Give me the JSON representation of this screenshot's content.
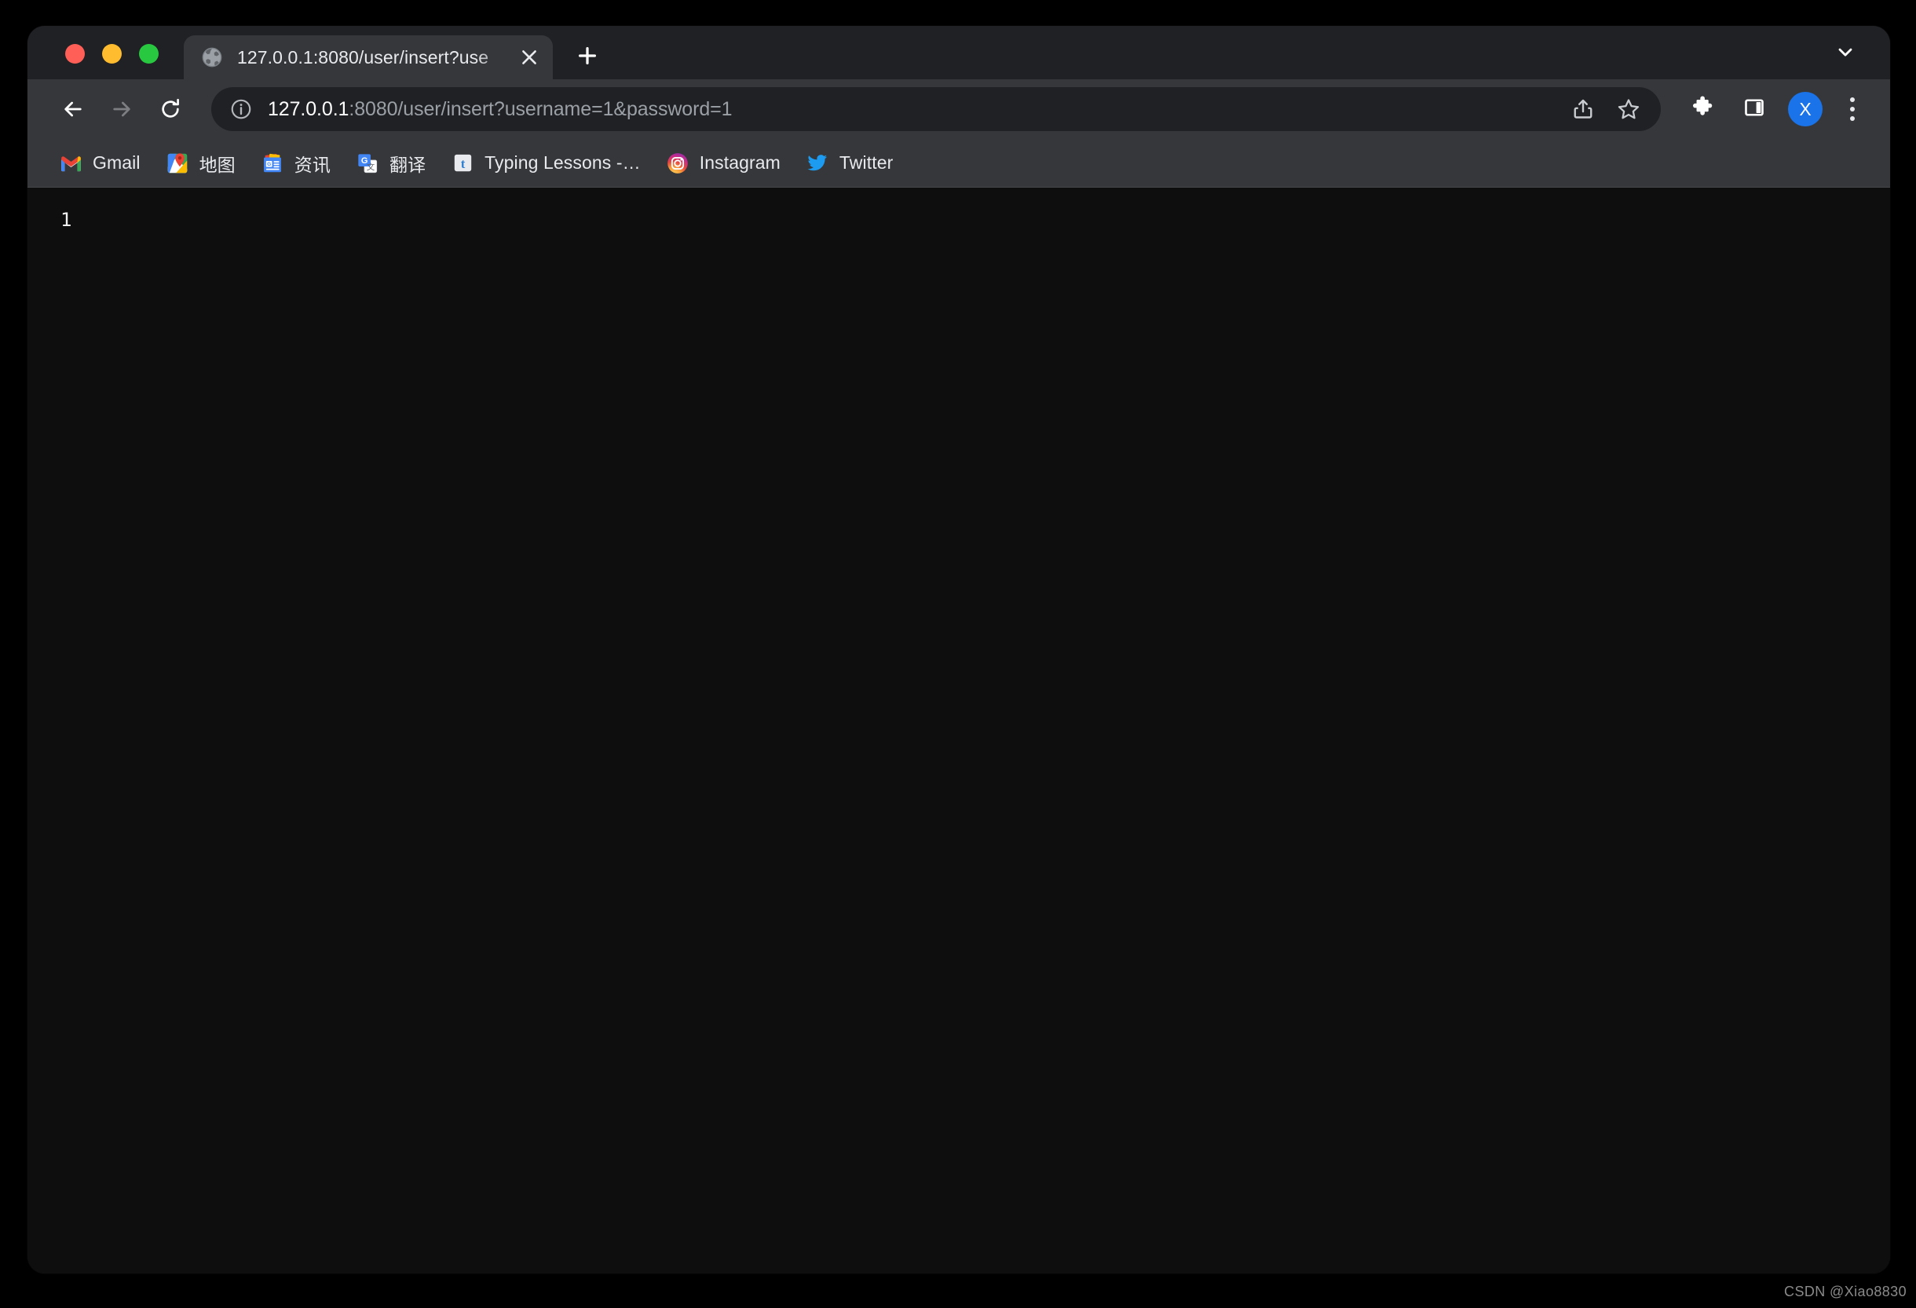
{
  "window": {
    "traffic_lights": [
      {
        "name": "close",
        "color": "#ff5f57"
      },
      {
        "name": "minimize",
        "color": "#febc2e"
      },
      {
        "name": "maximize",
        "color": "#28c840"
      }
    ]
  },
  "tabstrip": {
    "tab": {
      "title": "127.0.0.1:8080/user/insert?use",
      "favicon": "globe-icon",
      "close_label": "✕"
    },
    "new_tab_label": "+",
    "tab_search_icon": "chevron-down-icon"
  },
  "toolbar": {
    "back_icon": "arrow-left-icon",
    "forward_icon": "arrow-right-icon",
    "reload_icon": "reload-icon",
    "site_info_icon": "info-circle-icon",
    "url": {
      "host": "127.0.0.1",
      "rest": ":8080/user/insert?username=1&password=1",
      "full": "127.0.0.1:8080/user/insert?username=1&password=1"
    },
    "share_icon": "share-icon",
    "bookmark_icon": "star-icon",
    "extensions_icon": "puzzle-icon",
    "side_panel_icon": "side-panel-icon",
    "avatar_initial": "X",
    "avatar_color": "#1a73e8",
    "menu_icon": "three-dots-icon"
  },
  "bookmarks": [
    {
      "label": "Gmail",
      "icon": "gmail-icon"
    },
    {
      "label": "地图",
      "icon": "google-maps-icon"
    },
    {
      "label": "资讯",
      "icon": "google-news-icon"
    },
    {
      "label": "翻译",
      "icon": "google-translate-icon"
    },
    {
      "label": "Typing Lessons -…",
      "icon": "typing-lessons-icon"
    },
    {
      "label": "Instagram",
      "icon": "instagram-icon"
    },
    {
      "label": "Twitter",
      "icon": "twitter-icon"
    }
  ],
  "content": {
    "body_text": "1",
    "background_color": "#0e0e0e"
  },
  "watermark": {
    "text": "CSDN @Xiao8830"
  }
}
